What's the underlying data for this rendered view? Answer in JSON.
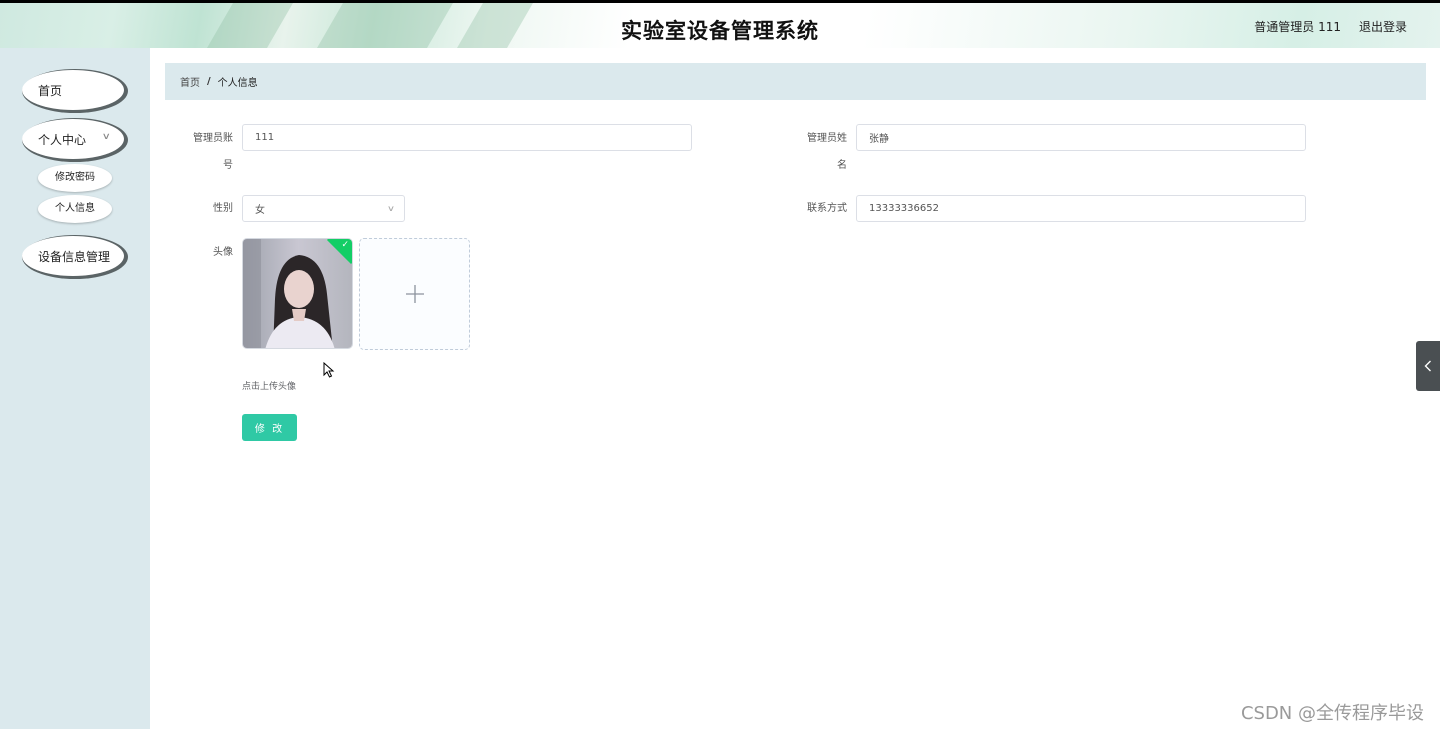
{
  "header": {
    "title": "实验室设备管理系统",
    "user_label": "普通管理员 111",
    "logout_label": "退出登录"
  },
  "sidebar": {
    "items": [
      {
        "label": "首页"
      },
      {
        "label": "个人中心",
        "expanded": true,
        "children": [
          {
            "label": "修改密码"
          },
          {
            "label": "个人信息"
          }
        ]
      },
      {
        "label": "设备信息管理"
      }
    ]
  },
  "breadcrumb": {
    "home": "首页",
    "separator": "/",
    "current": "个人信息"
  },
  "form": {
    "account_label_1": "管理员账",
    "account_label_2": "号",
    "account_value": "111",
    "name_label_1": "管理员姓",
    "name_label_2": "名",
    "name_value": "张静",
    "gender_label": "性别",
    "gender_value": "女",
    "phone_label": "联系方式",
    "phone_value": "13333336652",
    "avatar_label": "头像",
    "upload_hint": "点击上传头像",
    "submit_label": "修 改"
  },
  "colors": {
    "accent": "#2fc9a5",
    "sidebar_bg": "#dbe9ed",
    "upload_success": "#13ce66"
  },
  "icons": {
    "select_arrow": "chevron-down-icon",
    "upload": "plus-icon",
    "toggle": "chevron-left-icon",
    "success": "check-icon"
  },
  "watermark": "CSDN @全传程序毕设"
}
